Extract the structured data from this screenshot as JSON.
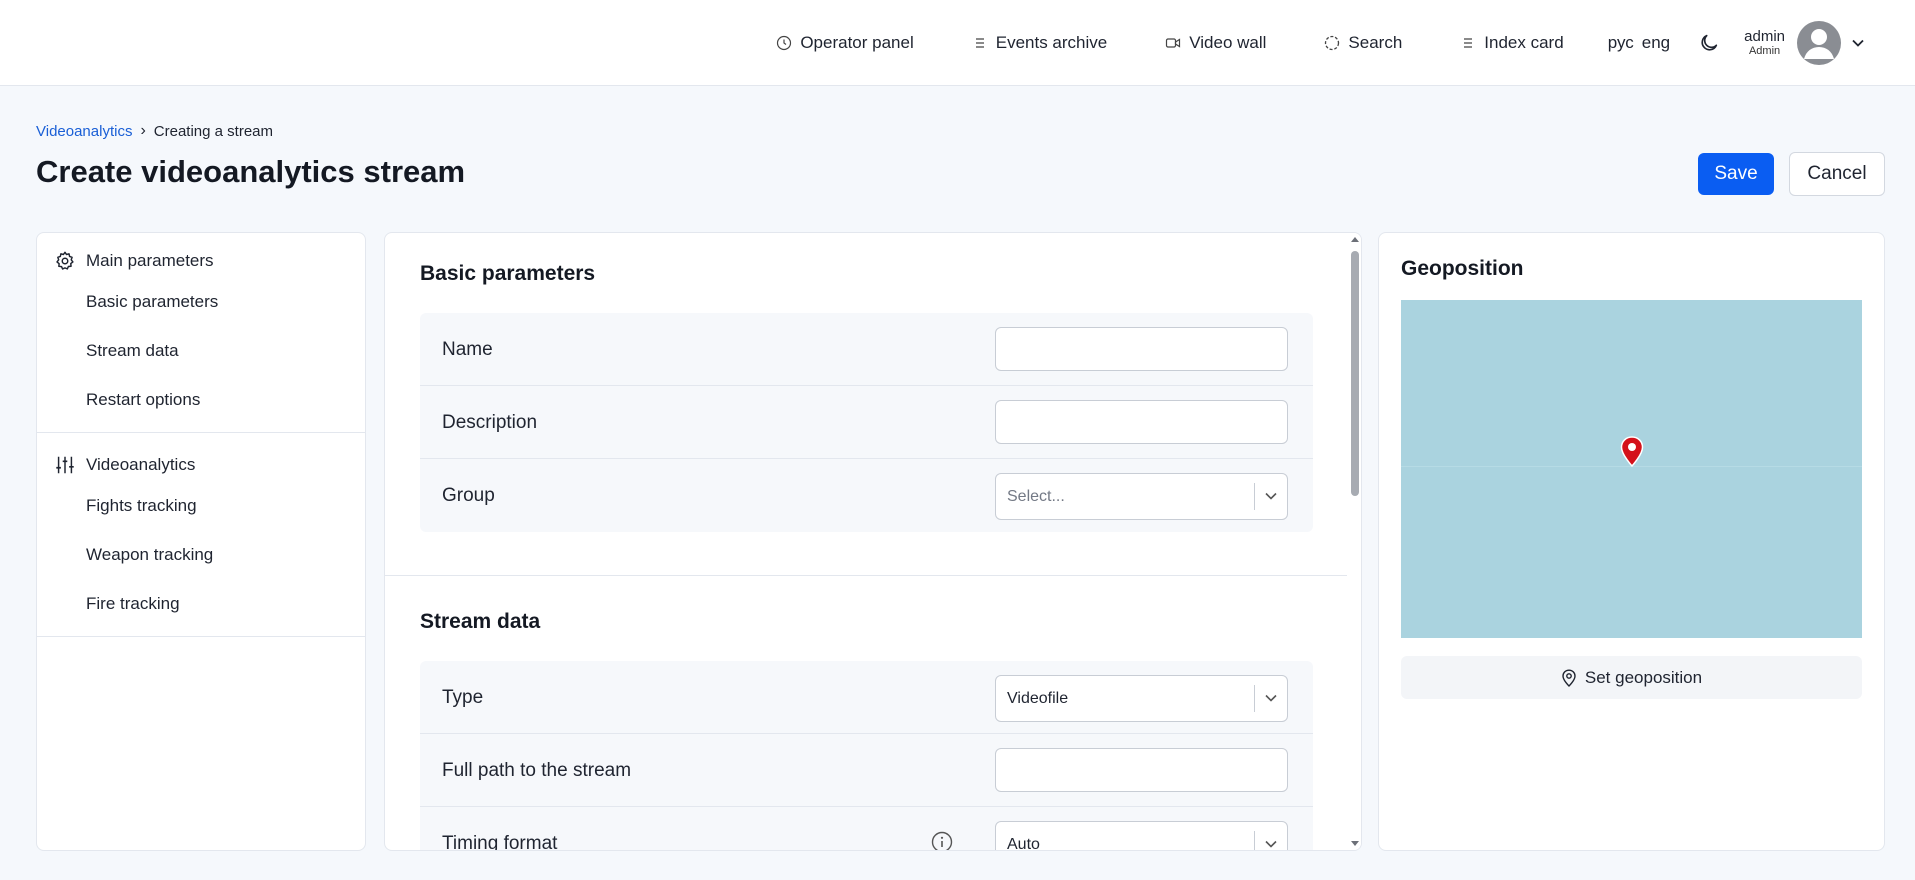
{
  "nav": {
    "items": [
      {
        "label": "Operator panel",
        "icon": "clock-icon"
      },
      {
        "label": "Events archive",
        "icon": "list-icon"
      },
      {
        "label": "Video wall",
        "icon": "video-camera-icon"
      },
      {
        "label": "Search",
        "icon": "search-dashed-circle-icon"
      },
      {
        "label": "Index card",
        "icon": "list-icon"
      }
    ],
    "lang_ru": "рус",
    "lang_en": "eng",
    "user_name": "admin",
    "user_role": "Admin"
  },
  "breadcrumb": {
    "parent": "Videoanalytics",
    "current": "Creating a stream"
  },
  "page": {
    "title": "Create videoanalytics stream",
    "save_label": "Save",
    "cancel_label": "Cancel"
  },
  "sidebar": {
    "sections": [
      {
        "title": "Main parameters",
        "icon": "gear-icon",
        "items": [
          "Basic parameters",
          "Stream data",
          "Restart options"
        ]
      },
      {
        "title": "Videoanalytics",
        "icon": "sliders-icon",
        "items": [
          "Fights tracking",
          "Weapon tracking",
          "Fire tracking"
        ]
      }
    ]
  },
  "form": {
    "basic": {
      "title": "Basic parameters",
      "name_label": "Name",
      "name_value": "",
      "description_label": "Description",
      "description_value": "",
      "group_label": "Group",
      "group_placeholder": "Select..."
    },
    "stream": {
      "title": "Stream data",
      "type_label": "Type",
      "type_value": "Videofile",
      "path_label": "Full path to the stream",
      "path_value": "",
      "timing_label": "Timing format",
      "timing_value": "Auto"
    }
  },
  "geo": {
    "title": "Geoposition",
    "button_label": "Set geoposition",
    "map_bg": "#aad3df",
    "pin_color": "#d4111a"
  },
  "colors": {
    "accent": "#0a5df2",
    "link": "#1a5fd6"
  }
}
